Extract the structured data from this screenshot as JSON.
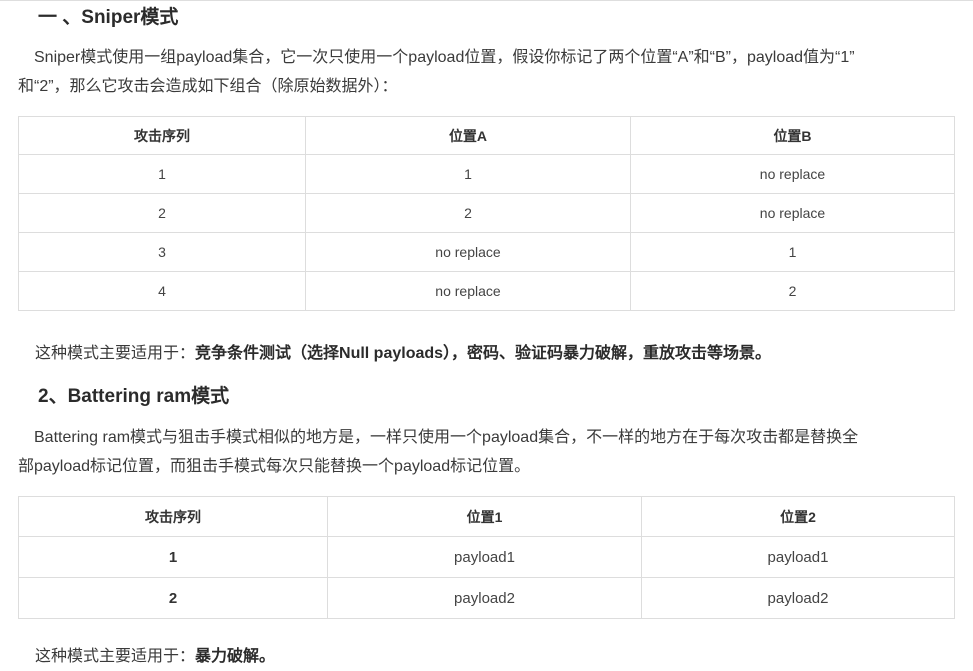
{
  "section1": {
    "heading": "一 、Sniper模式",
    "paragraph_line1": "Sniper模式使用一组payload集合，它一次只使用一个payload位置，假设你标记了两个位置“A”和“B”，payload值为“1”",
    "paragraph_line2": "和“2”，那么它攻击会造成如下组合（除原始数据外）：",
    "table": {
      "headers": [
        "攻击序列",
        "位置A",
        "位置B"
      ],
      "rows": [
        [
          "1",
          "1",
          "no replace"
        ],
        [
          "2",
          "2",
          "no replace"
        ],
        [
          "3",
          "no replace",
          "1"
        ],
        [
          "4",
          "no replace",
          "2"
        ]
      ]
    },
    "usage_prefix": "这种模式主要适用于：",
    "usage_bold": "竞争条件测试（选择Null payloads），密码、验证码暴力破解，重放攻击等场景。"
  },
  "section2": {
    "heading": "2、Battering ram模式",
    "paragraph_line1": "Battering ram模式与狙击手模式相似的地方是，一样只使用一个payload集合，不一样的地方在于每次攻击都是替换全",
    "paragraph_line2": "部payload标记位置，而狙击手模式每次只能替换一个payload标记位置。",
    "table": {
      "headers": [
        "攻击序列",
        "位置1",
        "位置2"
      ],
      "rows": [
        [
          "1",
          "payload1",
          "payload1"
        ],
        [
          "2",
          "payload2",
          "payload2"
        ]
      ]
    },
    "usage_prefix": "这种模式主要适用于：",
    "usage_bold": "暴力破解。"
  }
}
